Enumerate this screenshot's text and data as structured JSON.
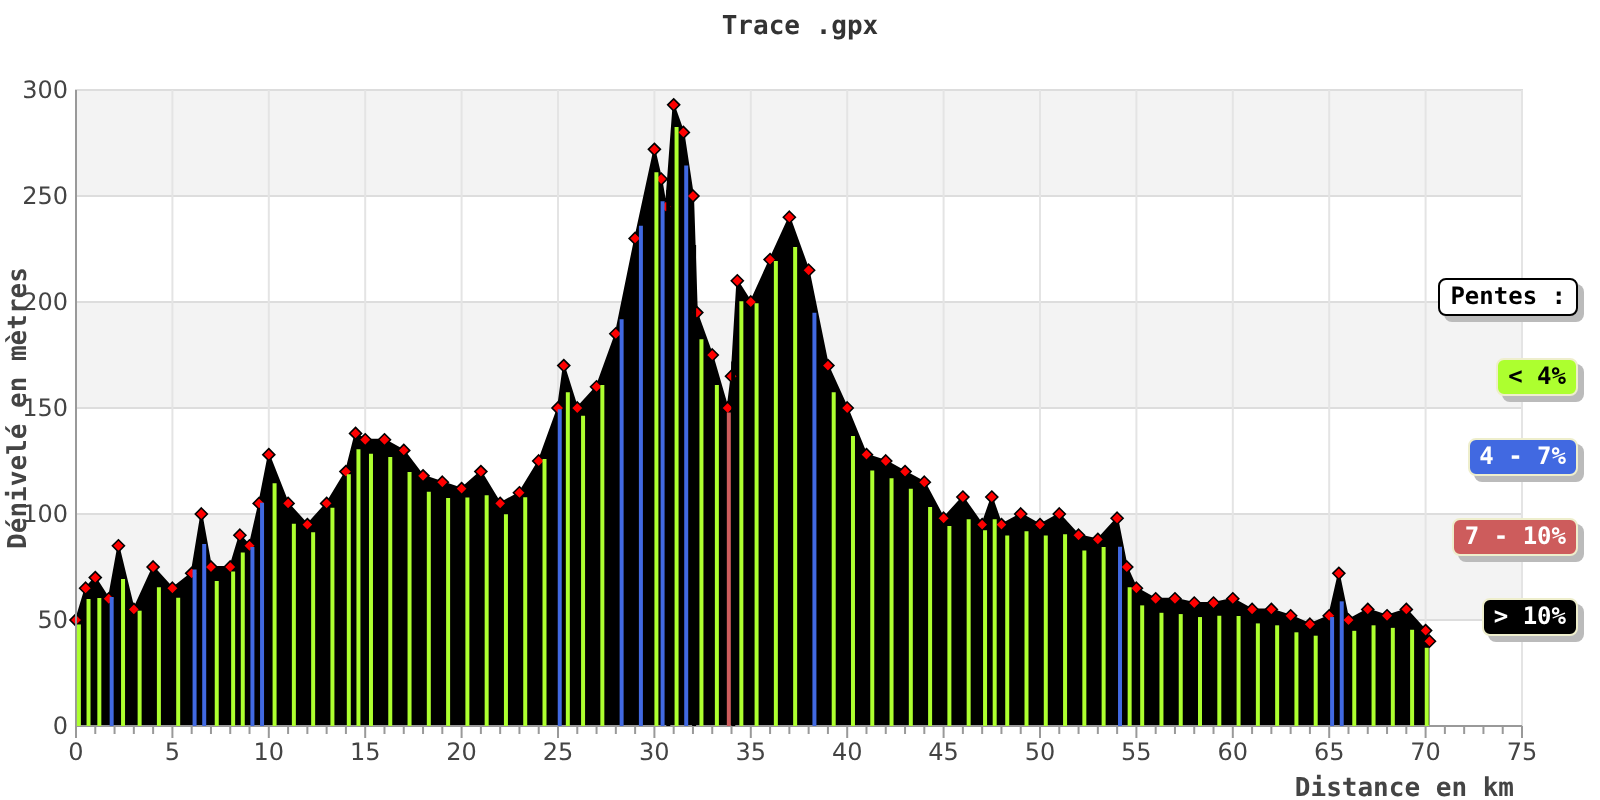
{
  "chart": {
    "chart_data": {
      "type": "area",
      "title": "Trace .gpx",
      "xlabel": "Distance en km",
      "ylabel": "Dénivelé en mètres",
      "grid": true,
      "x": [
        0,
        0.5,
        1,
        1.7,
        2.2,
        3,
        4,
        5,
        6,
        6.5,
        7,
        8,
        8.5,
        9,
        9.5,
        10,
        11,
        12,
        13,
        14,
        14.5,
        15,
        16,
        17,
        18,
        19,
        20,
        21,
        22,
        23,
        24,
        25,
        25.3,
        26,
        27,
        28,
        29,
        30,
        30.35,
        30.6,
        31,
        31.5,
        32,
        32.2,
        33,
        33.8,
        34,
        34.3,
        35,
        36,
        37,
        38,
        39,
        40,
        41,
        42,
        43,
        44,
        45,
        46,
        47,
        47.5,
        48,
        49,
        50,
        51,
        52,
        53,
        54,
        54.5,
        55,
        56,
        57,
        58,
        59,
        60,
        61,
        62,
        63,
        64,
        65,
        65.5,
        66,
        67,
        68,
        69,
        70,
        70.2
      ],
      "series": [
        {
          "color": "#000000",
          "values": [
            50,
            65,
            70,
            60,
            85,
            55,
            75,
            65,
            72,
            100,
            75,
            75,
            90,
            85,
            105,
            128,
            105,
            95,
            105,
            120,
            138,
            135,
            135,
            130,
            118,
            115,
            112,
            120,
            105,
            110,
            125,
            150,
            170,
            150,
            160,
            185,
            230,
            272,
            258,
            245,
            293,
            280,
            250,
            195,
            175,
            150,
            165,
            210,
            200,
            220,
            240,
            215,
            170,
            150,
            128,
            125,
            120,
            115,
            98,
            108,
            95,
            108,
            95,
            100,
            95,
            100,
            90,
            88,
            98,
            75,
            65,
            60,
            60,
            58,
            58,
            60,
            55,
            55,
            52,
            48,
            52,
            72,
            50,
            55,
            52,
            55,
            45,
            40
          ]
        }
      ],
      "xlim": [
        0,
        75
      ],
      "ylim": [
        0,
        300
      ],
      "xticks": [
        0,
        5,
        10,
        15,
        20,
        25,
        30,
        35,
        40,
        45,
        50,
        55,
        60,
        65,
        70,
        75
      ],
      "yticks": [
        0,
        50,
        100,
        150,
        200,
        250,
        300
      ]
    }
  },
  "legend": {
    "title": "Pentes :",
    "items": [
      {
        "label": "< 4%",
        "color": "#adff2f"
      },
      {
        "label": "4 - 7%",
        "color": "#4169e1"
      },
      {
        "label": "7 - 10%",
        "color": "#cd5c5c"
      },
      {
        "label": "> 10%",
        "color": "#000000"
      }
    ]
  }
}
